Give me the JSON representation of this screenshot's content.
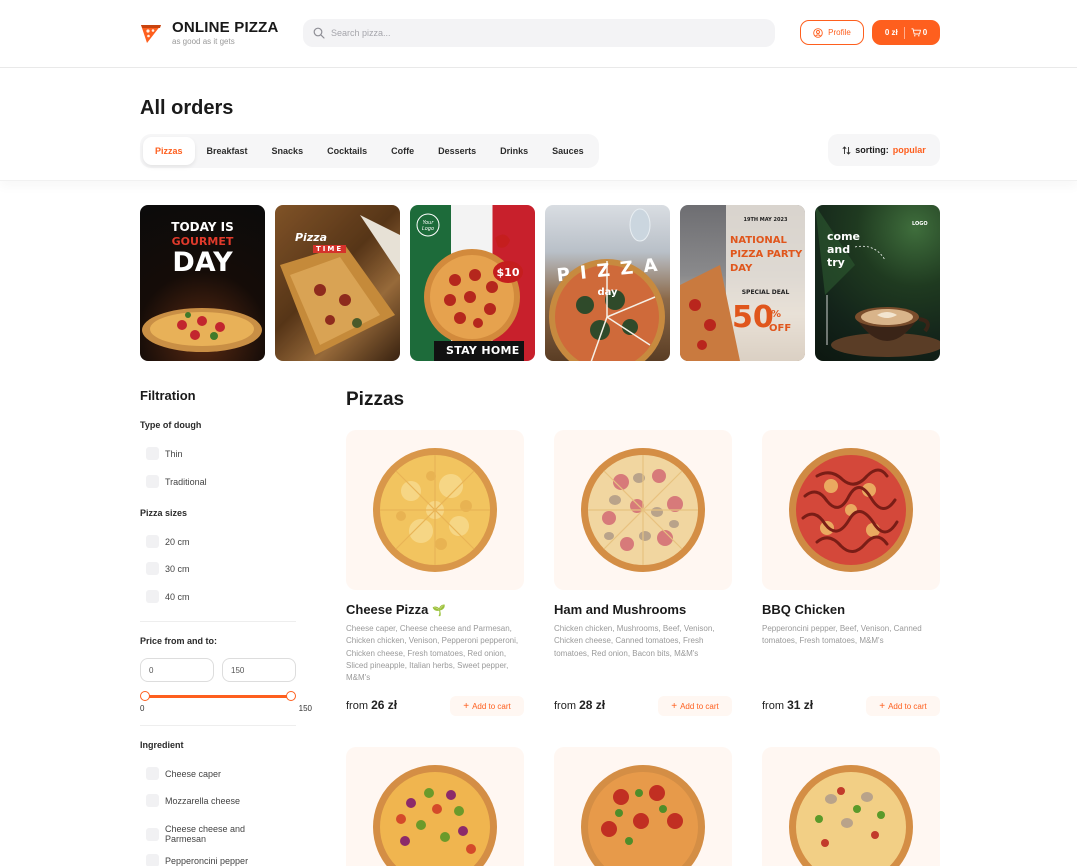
{
  "header": {
    "brand": "ONLINE PIZZA",
    "tagline": "as good as it gets",
    "search_placeholder": "Search pizza...",
    "profile_label": "Profile",
    "cart_total": "0 zł",
    "cart_count": "0",
    "accent_color": "#fe5f1e"
  },
  "page": {
    "title": "All orders",
    "categories": [
      "Pizzas",
      "Breakfast",
      "Snacks",
      "Cocktails",
      "Coffe",
      "Desserts",
      "Drinks",
      "Sauces"
    ],
    "active_category": "Pizzas",
    "sorting_label": "sorting:",
    "sorting_value": "popular"
  },
  "banners": [
    {
      "lines": [
        "TODAY IS",
        "GOURMET",
        "DAY"
      ]
    },
    {
      "lines": [
        "Pizza",
        "TIME"
      ]
    },
    {
      "lines": [
        "Your",
        "Logo",
        "$10",
        "STAY HOME"
      ]
    },
    {
      "lines": [
        "P I Z Z A",
        "day"
      ]
    },
    {
      "lines": [
        "19TH MAY 2023",
        "NATIONAL",
        "PIZZA PARTY",
        "DAY",
        "SPECIAL DEAL",
        "50",
        "%",
        "OFF"
      ]
    },
    {
      "lines": [
        "come",
        "and",
        "try",
        "LOGO"
      ]
    }
  ],
  "sidebar": {
    "title": "Filtration",
    "dough_title": "Type of dough",
    "dough": [
      "Thin",
      "Traditional"
    ],
    "sizes_title": "Pizza sizes",
    "sizes": [
      "20 cm",
      "30 cm",
      "40 cm"
    ],
    "price_title": "Price from and to:",
    "price_from": "0",
    "price_to": "150",
    "range_min": "0",
    "range_max": "150",
    "ingredient_title": "Ingredient",
    "ingredients": [
      "Cheese caper",
      "Mozzarella cheese",
      "Cheese cheese and Parmesan",
      "Pepperoncini pepper"
    ]
  },
  "main": {
    "title": "Pizzas",
    "products": [
      {
        "name": "Cheese Pizza",
        "veg_icon": "🌱",
        "description": "Cheese caper, Cheese cheese and Parmesan, Chicken chicken, Venison, Pepperoni pepperoni, Chicken cheese, Fresh tomatoes, Red onion, Sliced pineapple, Italian herbs, Sweet pepper, M&M's",
        "price_prefix": "from",
        "price": "26 zł",
        "button": "Add to cart"
      },
      {
        "name": "Ham and Mushrooms",
        "description": "Chicken chicken, Mushrooms, Beef, Venison, Chicken cheese, Canned tomatoes, Fresh tomatoes, Red onion, Bacon bits, M&M's",
        "price_prefix": "from",
        "price": "28 zł",
        "button": "Add to cart"
      },
      {
        "name": "BBQ Chicken",
        "description": "Pepperoncini pepper, Beef, Venison, Canned tomatoes, Fresh tomatoes, M&M's",
        "price_prefix": "from",
        "price": "31 zł",
        "button": "Add to cart"
      }
    ]
  }
}
